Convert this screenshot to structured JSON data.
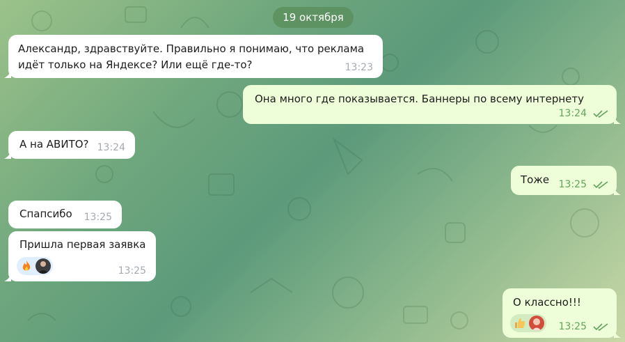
{
  "date_separator": "19 октября",
  "messages": [
    {
      "text_line1": "Александр, здравствуйте. Правильно я понимаю, что реклама",
      "text_line2": "идёт только на Яндексе? Или ещё где-то?",
      "time": "13:23"
    },
    {
      "text": "Она много где показывается. Баннеры по всему интернету",
      "time": "13:24"
    },
    {
      "text": "А на АВИТО?",
      "time": "13:24"
    },
    {
      "text": "Тоже",
      "time": "13:25"
    },
    {
      "text": "Спапсибо",
      "time": "13:25"
    },
    {
      "text": "Пришла первая заявка",
      "time": "13:25",
      "reaction": "fire"
    },
    {
      "text": "О классно!!!",
      "time": "13:25",
      "reaction": "thumbs-up"
    }
  ],
  "colors": {
    "incoming_bubble": "#ffffff",
    "outgoing_bubble": "#eefed8",
    "outgoing_time": "#62a35c",
    "incoming_time": "#a3aab1",
    "date_pill": "#5a8c5a"
  },
  "icons": {
    "read_receipt": "double-check-icon",
    "fire": "fire-emoji-icon",
    "thumbs_up": "thumbs-up-emoji-icon"
  }
}
